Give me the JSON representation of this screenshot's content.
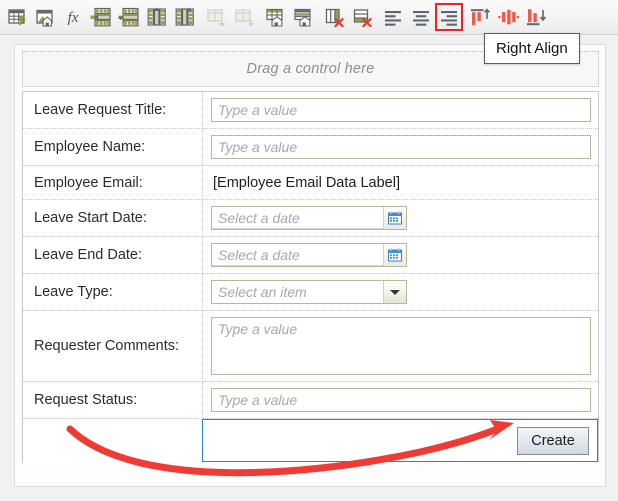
{
  "toolbar": {
    "items": [
      {
        "name": "edit-datasource-icon",
        "label": "Edit DataSource"
      },
      {
        "name": "edit-master-icon",
        "label": "Edit Master"
      },
      {
        "name": "formula-icon",
        "label": "fx"
      },
      {
        "name": "insert-row-above-icon",
        "label": "Insert Row Above"
      },
      {
        "name": "insert-row-below-icon",
        "label": "Insert Row Below"
      },
      {
        "name": "insert-column-left-icon",
        "label": "Insert Column Left"
      },
      {
        "name": "insert-column-right-icon",
        "label": "Insert Column Right"
      },
      {
        "name": "merge-cells-right-icon",
        "label": "Merge Cells Right"
      },
      {
        "name": "merge-cells-down-icon",
        "label": "Merge Cells Down"
      },
      {
        "name": "split-cells-horizontal-icon",
        "label": "Split Cells Horizontally"
      },
      {
        "name": "split-cells-vertical-icon",
        "label": "Split Cells Vertically"
      },
      {
        "name": "delete-column-icon",
        "label": "Delete Column"
      },
      {
        "name": "delete-row-icon",
        "label": "Delete Row"
      },
      {
        "name": "left-align-icon",
        "label": "Left Align"
      },
      {
        "name": "center-align-icon",
        "label": "Center Align"
      },
      {
        "name": "right-align-icon",
        "label": "Right Align"
      },
      {
        "name": "top-align-icon",
        "label": "Top Align"
      },
      {
        "name": "middle-align-icon",
        "label": "Middle Align"
      },
      {
        "name": "bottom-align-icon",
        "label": "Bottom Align"
      }
    ],
    "selected_index": 15
  },
  "tooltip": {
    "text": "Right Align"
  },
  "canvas": {
    "drop_zone_text": "Drag a control here",
    "rows": [
      {
        "label": "Leave Request Title:",
        "control": "textbox",
        "placeholder": "Type a value",
        "value": ""
      },
      {
        "label": "Employee Name:",
        "control": "textbox",
        "placeholder": "Type a value",
        "value": ""
      },
      {
        "label": "Employee Email:",
        "control": "static",
        "value": "[Employee Email Data Label]"
      },
      {
        "label": "Leave Start Date:",
        "control": "datepicker",
        "placeholder": "Select a date",
        "value": ""
      },
      {
        "label": "Leave End Date:",
        "control": "datepicker",
        "placeholder": "Select a date",
        "value": ""
      },
      {
        "label": "Leave Type:",
        "control": "combobox",
        "placeholder": "Select an item",
        "value": ""
      },
      {
        "label": "Requester Comments:",
        "control": "textarea",
        "placeholder": "Type a value",
        "value": ""
      },
      {
        "label": "Request Status:",
        "control": "textbox",
        "placeholder": "Type a value",
        "value": ""
      }
    ],
    "footer": {
      "label": "",
      "button_label": "Create"
    }
  },
  "annotation": {
    "arrow_color": "#ef3b33"
  },
  "colors": {
    "accent_red": "#ef3b33",
    "selection_blue": "#2f7fd0",
    "icon_olive": "#9aa03a",
    "icon_gray": "#5b6670",
    "toolbar_bg": "#f3f3f3"
  }
}
